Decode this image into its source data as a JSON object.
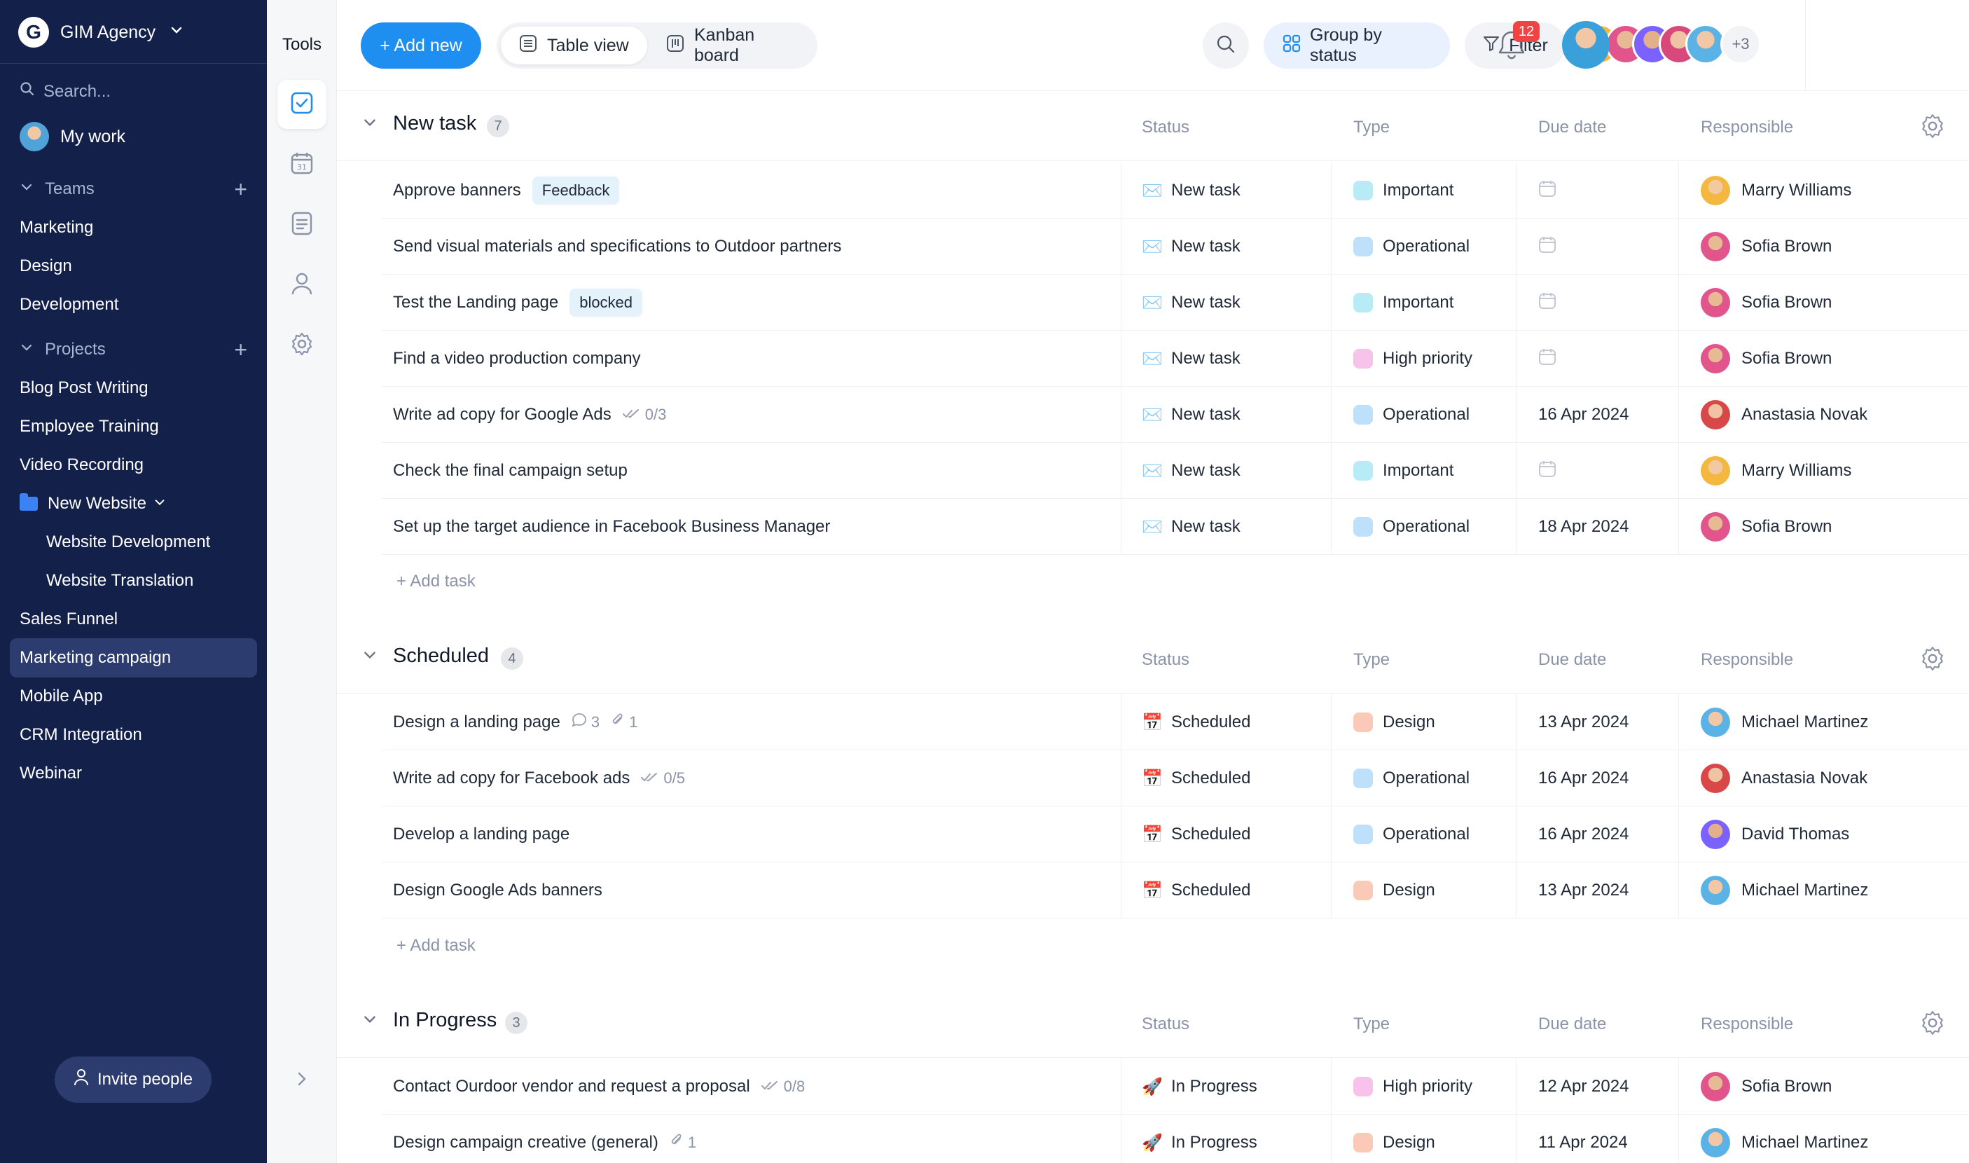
{
  "workspace": {
    "name": "GIM Agency",
    "logo_letter": "G"
  },
  "search": {
    "placeholder": "Search..."
  },
  "my_work": "My work",
  "teams": {
    "label": "Teams",
    "items": [
      "Marketing",
      "Design",
      "Development"
    ]
  },
  "projects": {
    "label": "Projects",
    "items": [
      "Blog Post Writing",
      "Employee Training",
      "Video Recording"
    ],
    "folder": {
      "label": "New Website",
      "children": [
        "Website Development",
        "Website Translation"
      ]
    },
    "more_items": [
      "Sales Funnel",
      "Marketing campaign",
      "Mobile App",
      "CRM Integration",
      "Webinar"
    ],
    "active": "Marketing campaign"
  },
  "invite_label": "Invite people",
  "tools_title": "Tools",
  "toolbar": {
    "add_new": "+ Add new",
    "table_view": "Table view",
    "kanban_board": "Kanban board",
    "group_by": "Group by status",
    "filter": "Filter",
    "avatars_more": "+3",
    "notifications_count": "12"
  },
  "columns": {
    "status": "Status",
    "type": "Type",
    "due": "Due date",
    "responsible": "Responsible"
  },
  "add_task_label": "+ Add task",
  "colors": {
    "accent": "#1f8ef1",
    "sidebar": "#13214a",
    "type_important": "#b7ecf7",
    "type_operational": "#bfe0fb",
    "type_high": "#f7c3ea",
    "type_design": "#fbc9b8"
  },
  "groups": [
    {
      "title": "New task",
      "count": "7",
      "tasks": [
        {
          "name": "Approve banners",
          "tag": "Feedback",
          "status": "New task",
          "status_icon": "envelope-icon",
          "type": "Important",
          "due": "",
          "responsible": "Marry Williams"
        },
        {
          "name": "Send visual materials and specifications to Outdoor partners",
          "status": "New task",
          "status_icon": "envelope-icon",
          "type": "Operational",
          "due": "",
          "responsible": "Sofia Brown"
        },
        {
          "name": "Test the Landing page",
          "tag": "blocked",
          "status": "New task",
          "status_icon": "envelope-icon",
          "type": "Important",
          "due": "",
          "responsible": "Sofia Brown"
        },
        {
          "name": "Find a video production company",
          "status": "New task",
          "status_icon": "envelope-icon",
          "type": "High priority",
          "due": "",
          "responsible": "Sofia Brown"
        },
        {
          "name": "Write ad copy for Google Ads",
          "checklist": "0/3",
          "status": "New task",
          "status_icon": "envelope-icon",
          "type": "Operational",
          "due": "16 Apr 2024",
          "responsible": "Anastasia Novak"
        },
        {
          "name": "Check the final campaign setup",
          "status": "New task",
          "status_icon": "envelope-icon",
          "type": "Important",
          "due": "",
          "responsible": "Marry Williams"
        },
        {
          "name": "Set up the target audience in Facebook Business Manager",
          "status": "New task",
          "status_icon": "envelope-icon",
          "type": "Operational",
          "due": "18 Apr 2024",
          "responsible": "Sofia Brown"
        }
      ]
    },
    {
      "title": "Scheduled",
      "count": "4",
      "tasks": [
        {
          "name": "Design a landing page",
          "comments": "3",
          "attachments": "1",
          "status": "Scheduled",
          "status_icon": "calendar-icon",
          "type": "Design",
          "due": "13 Apr 2024",
          "responsible": "Michael Martinez"
        },
        {
          "name": "Write ad copy for Facebook ads",
          "checklist": "0/5",
          "status": "Scheduled",
          "status_icon": "calendar-icon",
          "type": "Operational",
          "due": "16 Apr 2024",
          "responsible": "Anastasia Novak"
        },
        {
          "name": "Develop a landing page",
          "status": "Scheduled",
          "status_icon": "calendar-icon",
          "type": "Operational",
          "due": "16 Apr 2024",
          "responsible": "David Thomas"
        },
        {
          "name": "Design Google Ads banners",
          "status": "Scheduled",
          "status_icon": "calendar-icon",
          "type": "Design",
          "due": "13 Apr 2024",
          "responsible": "Michael Martinez"
        }
      ]
    },
    {
      "title": "In Progress",
      "count": "3",
      "tasks": [
        {
          "name": "Contact Ourdoor vendor and request a proposal",
          "checklist": "0/8",
          "status": "In Progress",
          "status_icon": "rocket-icon",
          "type": "High priority",
          "due": "12 Apr 2024",
          "responsible": "Sofia Brown"
        },
        {
          "name": "Design campaign creative (general)",
          "attachments": "1",
          "status": "In Progress",
          "status_icon": "rocket-icon",
          "type": "Design",
          "due": "11 Apr 2024",
          "responsible": "Michael Martinez"
        }
      ]
    }
  ]
}
